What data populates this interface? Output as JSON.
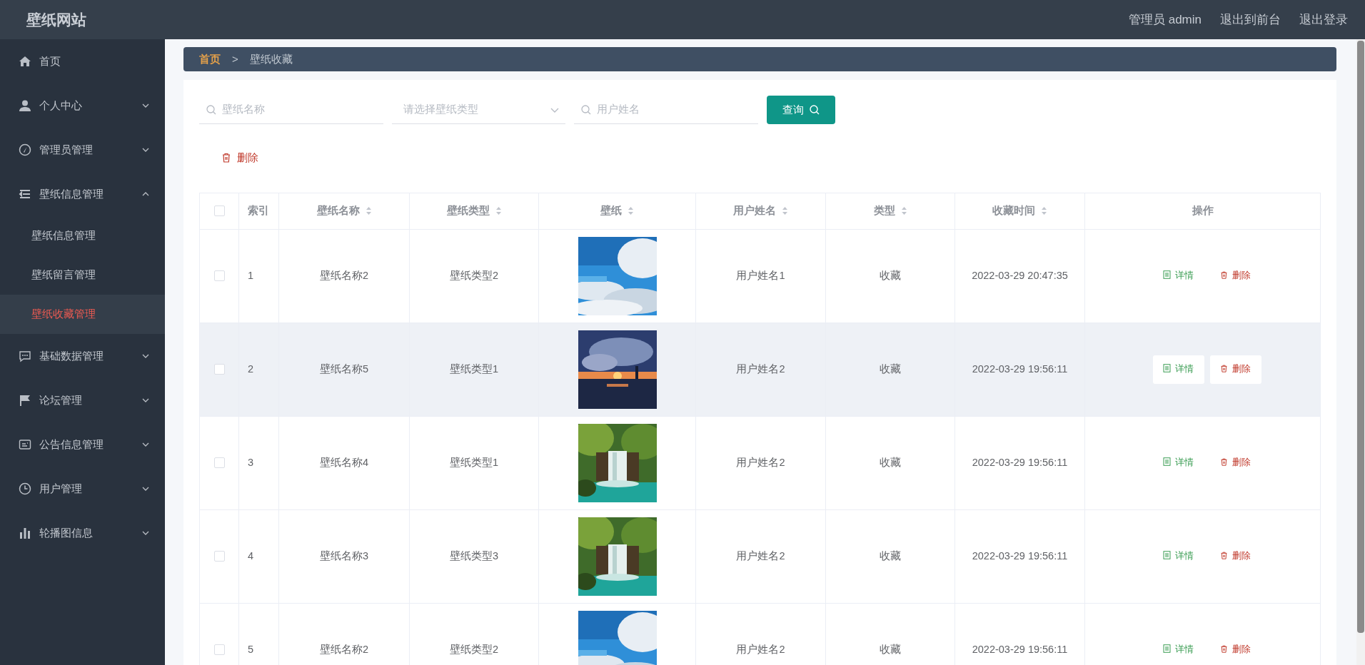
{
  "header": {
    "title": "壁纸网站",
    "links": [
      "管理员 admin",
      "退出到前台",
      "退出登录"
    ]
  },
  "sidebar": {
    "items": [
      {
        "label": "首页",
        "expandable": false
      },
      {
        "label": "个人中心",
        "expandable": true,
        "expanded": false
      },
      {
        "label": "管理员管理",
        "expandable": true,
        "expanded": false
      },
      {
        "label": "壁纸信息管理",
        "expandable": true,
        "expanded": true,
        "children": [
          {
            "label": "壁纸信息管理",
            "selected": false
          },
          {
            "label": "壁纸留言管理",
            "selected": false
          },
          {
            "label": "壁纸收藏管理",
            "selected": true
          }
        ]
      },
      {
        "label": "基础数据管理",
        "expandable": true,
        "expanded": false
      },
      {
        "label": "论坛管理",
        "expandable": true,
        "expanded": false
      },
      {
        "label": "公告信息管理",
        "expandable": true,
        "expanded": false
      },
      {
        "label": "用户管理",
        "expandable": true,
        "expanded": false
      },
      {
        "label": "轮播图信息",
        "expandable": true,
        "expanded": false
      }
    ]
  },
  "breadcrumb": {
    "items": [
      "首页",
      "壁纸收藏"
    ],
    "separator": ">"
  },
  "search": {
    "fields": [
      {
        "kind": "text",
        "placeholder": "壁纸名称"
      },
      {
        "kind": "select",
        "placeholder": "请选择壁纸类型"
      },
      {
        "kind": "text",
        "placeholder": "用户姓名"
      }
    ],
    "button": "查询"
  },
  "toolbar": {
    "delete_button": "删除"
  },
  "table": {
    "select_all": {
      "checked": false
    },
    "columns": [
      {
        "label": "索引",
        "sortable": false
      },
      {
        "label": "壁纸名称",
        "sortable": true
      },
      {
        "label": "壁纸类型",
        "sortable": true
      },
      {
        "label": "壁纸",
        "sortable": true
      },
      {
        "label": "用户姓名",
        "sortable": true
      },
      {
        "label": "类型",
        "sortable": true
      },
      {
        "label": "收藏时间",
        "sortable": true
      },
      {
        "label": "操作",
        "sortable": false
      }
    ],
    "rows": [
      {
        "checked": false,
        "hovered": false,
        "index": "1",
        "name": "壁纸名称2",
        "wallpaper_type": "壁纸类型2",
        "picture": {
          "kind": "picture"
        },
        "user_name": "用户姓名1",
        "type": "收藏",
        "time": "2022-03-29 20:47:35",
        "actions": [
          {
            "kind": "detail",
            "label": "详情"
          },
          {
            "kind": "delete",
            "label": "删除"
          }
        ]
      },
      {
        "checked": false,
        "hovered": true,
        "index": "2",
        "name": "壁纸名称5",
        "wallpaper_type": "壁纸类型1",
        "picture": {
          "kind": "picture"
        },
        "user_name": "用户姓名2",
        "type": "收藏",
        "time": "2022-03-29 19:56:11",
        "actions": [
          {
            "kind": "detail",
            "label": "详情"
          },
          {
            "kind": "delete",
            "label": "删除"
          }
        ]
      },
      {
        "checked": false,
        "hovered": false,
        "index": "3",
        "name": "壁纸名称4",
        "wallpaper_type": "壁纸类型1",
        "picture": {
          "kind": "picture"
        },
        "user_name": "用户姓名2",
        "type": "收藏",
        "time": "2022-03-29 19:56:11",
        "actions": [
          {
            "kind": "detail",
            "label": "详情"
          },
          {
            "kind": "delete",
            "label": "删除"
          }
        ]
      },
      {
        "checked": false,
        "hovered": false,
        "index": "4",
        "name": "壁纸名称3",
        "wallpaper_type": "壁纸类型3",
        "picture": {
          "kind": "picture"
        },
        "user_name": "用户姓名2",
        "type": "收藏",
        "time": "2022-03-29 19:56:11",
        "actions": [
          {
            "kind": "detail",
            "label": "详情"
          },
          {
            "kind": "delete",
            "label": "删除"
          }
        ]
      },
      {
        "checked": false,
        "hovered": false,
        "index": "5",
        "name": "壁纸名称2",
        "wallpaper_type": "壁纸类型2",
        "picture": {
          "kind": "picture"
        },
        "user_name": "用户姓名2",
        "type": "收藏",
        "time": "2022-03-29 19:56:11",
        "actions": [
          {
            "kind": "detail",
            "label": "详情"
          },
          {
            "kind": "delete",
            "label": "删除"
          }
        ]
      }
    ]
  }
}
